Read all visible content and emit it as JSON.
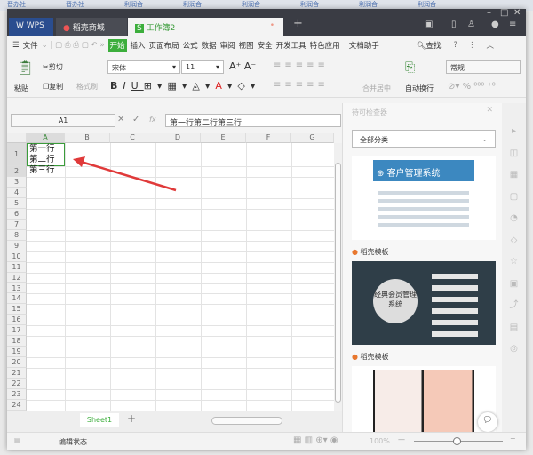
{
  "background_tabs": [
    "晋办社",
    "晋办社",
    "利润合",
    "利润合",
    "利润合",
    "利润合",
    "利润合",
    "利润合"
  ],
  "tabs": [
    {
      "label": "WPS"
    },
    {
      "label": "稻壳商城"
    },
    {
      "label": "工作簿2"
    }
  ],
  "menu": {
    "file": "文件",
    "items": [
      "开始",
      "插入",
      "页面布局",
      "公式",
      "数据",
      "审阅",
      "视图",
      "安全",
      "开发工具",
      "特色应用",
      "文档助手"
    ],
    "search": "查找"
  },
  "ribbon": {
    "paste": "粘贴",
    "cut": "剪切",
    "copy": "复制",
    "format_painter": "格式刷",
    "font": "宋体",
    "size": "11",
    "merge": "合并居中",
    "wrap": "自动换行",
    "number_format": "常规"
  },
  "formula_bar": {
    "cell_ref": "A1",
    "fx": "fx",
    "value": "第一行第二行第三行"
  },
  "columns": [
    "A",
    "B",
    "C",
    "D",
    "E",
    "F",
    "G"
  ],
  "rows": [
    "1",
    "2",
    "3",
    "4",
    "5",
    "6",
    "7",
    "8",
    "9",
    "10",
    "11",
    "12",
    "13",
    "14",
    "15",
    "16",
    "17",
    "18",
    "19",
    "20",
    "21",
    "22",
    "23",
    "24"
  ],
  "cell_a1": [
    "第一行",
    "第二行",
    "第三行"
  ],
  "sheet_tab": "Sheet1",
  "pane": {
    "title": "待可检查器",
    "category": "全部分类",
    "t1_title": "客户管理系统",
    "t2_title": "经典会员管理系统",
    "source": "稻壳模板"
  },
  "status": {
    "mode": "编辑状态",
    "zoom": "100%"
  },
  "colors": {
    "accent": "#3cae3c",
    "arrow": "#e03a3a"
  }
}
